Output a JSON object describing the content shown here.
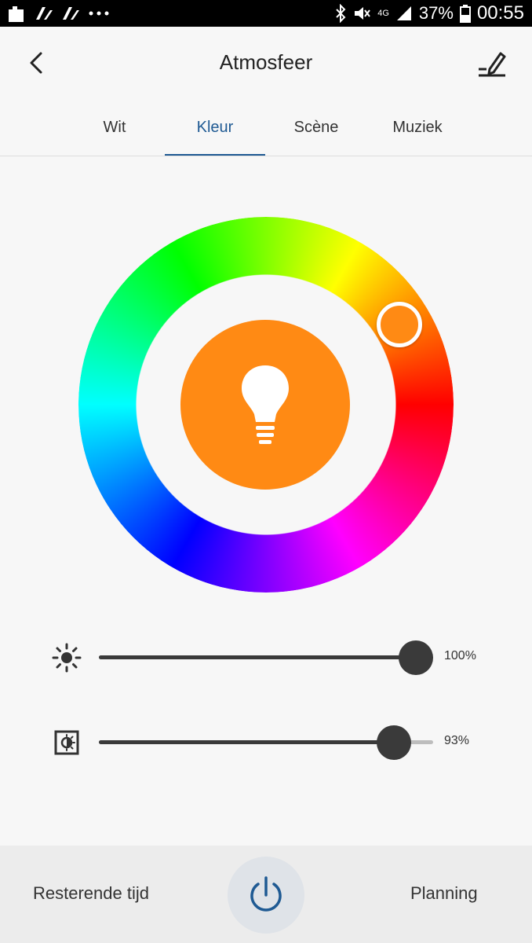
{
  "status_bar": {
    "battery_percent": "37%",
    "time": "00:55",
    "network": "4G",
    "icons": [
      "notification-icon",
      "app-icon",
      "app-icon",
      "more-dots-icon",
      "bluetooth-icon",
      "vibrate-off-icon",
      "signal-icon",
      "battery-icon"
    ]
  },
  "header": {
    "title": "Atmosfeer",
    "back_icon": "back-arrow-icon",
    "edit_icon": "edit-icon"
  },
  "tabs": [
    {
      "label": "Wit",
      "active": false
    },
    {
      "label": "Kleur",
      "active": true
    },
    {
      "label": "Scène",
      "active": false
    },
    {
      "label": "Muziek",
      "active": false
    }
  ],
  "color_wheel": {
    "selected_color": "#ff8a14",
    "center_icon": "bulb-icon"
  },
  "sliders": [
    {
      "name": "brightness",
      "icon": "brightness-icon",
      "value": 100,
      "label": "100%"
    },
    {
      "name": "contrast",
      "icon": "contrast-icon",
      "value": 93,
      "label": "93%"
    }
  ],
  "bottom_bar": {
    "left_label": "Resterende tijd",
    "right_label": "Planning",
    "power_icon": "power-icon",
    "accent_color": "#1f5a93"
  }
}
